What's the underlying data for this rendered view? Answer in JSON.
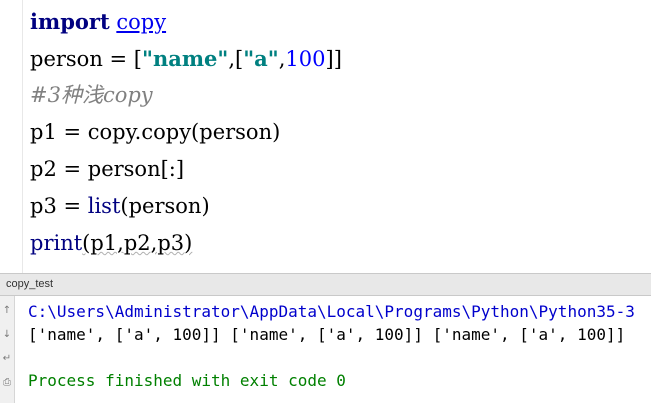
{
  "editor": {
    "lines": [
      {
        "keyword": "import",
        "module": "copy"
      },
      {
        "var": "person = [",
        "s1": "\"name\"",
        "mid": ",[",
        "s2": "\"a\"",
        "comma": ",",
        "num": "100",
        "close": "]]"
      },
      {
        "comment": "#3种浅copy"
      },
      {
        "text": "p1 = copy.copy(person)"
      },
      {
        "text": "p2 = person[:]"
      },
      {
        "pre": "p3 = ",
        "builtin": "list",
        "post": "(person)"
      },
      {
        "builtin": "print",
        "post": "(p1,p2,p3)"
      }
    ]
  },
  "run_panel": {
    "tab_label": "copy_test"
  },
  "console": {
    "path": "C:\\Users\\Administrator\\AppData\\Local\\Programs\\Python\\Python35-3",
    "output": "['name', ['a', 100]] ['name', ['a', 100]] ['name', ['a', 100]]",
    "finished": "Process finished with exit code 0"
  },
  "toolbar_icons": [
    "arrow-up-icon",
    "arrow-down-icon",
    "wrap-icon",
    "print-icon"
  ],
  "colors": {
    "keyword": "#000080",
    "string": "#008080",
    "number": "#0000ff",
    "comment": "#808080",
    "path": "#0000cc",
    "finished": "#008000"
  }
}
